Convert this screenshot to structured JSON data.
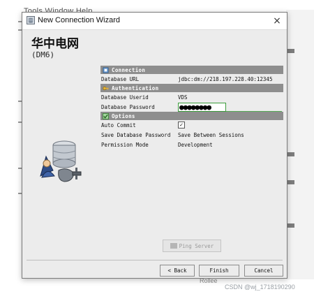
{
  "background": {
    "menu": "Tools   Window   Help",
    "bottom_text": "Rollee",
    "watermark": "CSDN @wj_1718190290"
  },
  "dialog": {
    "title": "New Connection Wizard",
    "close_glyph": "×",
    "header_title": "华中电网",
    "header_subtitle": "(DM6)",
    "sections": {
      "connection": "Connection",
      "authentication": "Authentication",
      "options": "Options"
    },
    "fields": {
      "database_url_label": "Database URL",
      "database_url_value": "jdbc:dm://218.197.228.40:12345",
      "userid_label": "Database Userid",
      "userid_value": "VDS",
      "password_label": "Database Password",
      "password_value": "●●●●●●●●",
      "auto_commit_label": "Auto Commit",
      "auto_commit_checked": true,
      "auto_commit_mark": "✓",
      "save_password_label": "Save Database Password",
      "save_password_value": "Save Between Sessions",
      "permission_label": "Permission Mode",
      "permission_value": "Development"
    },
    "buttons": {
      "ping": "Ping Server",
      "back": "< Back",
      "finish": "Finish",
      "cancel": "Cancel"
    }
  },
  "colors": {
    "section_header": "#8e8e8e",
    "password_focus": "#3a9b3a",
    "dialog_bg": "#ececec"
  }
}
